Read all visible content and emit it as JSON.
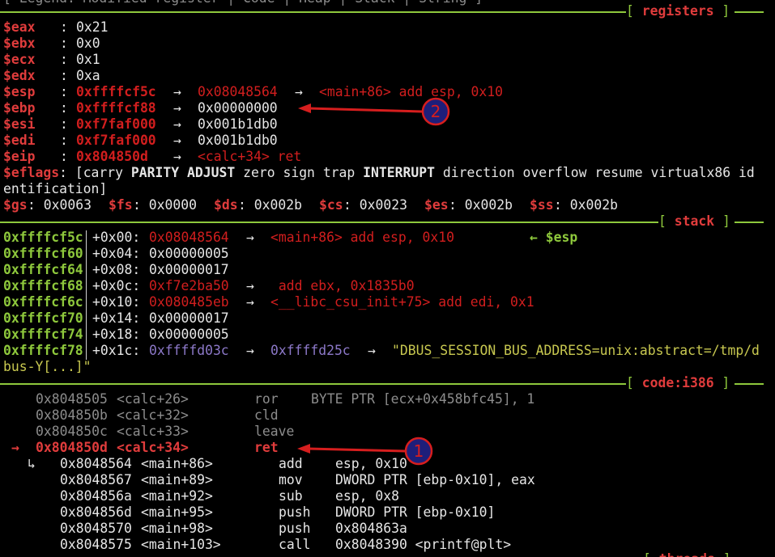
{
  "colors": {
    "background": "#000000",
    "register_name": "#e03c3c",
    "pointer": "#d21e1e",
    "section_rule": "#8ec83c",
    "stack_address": "#8ec83c",
    "text": "#d2d2d2",
    "string_value": "#c8c850",
    "heap_value": "#8c78c8",
    "annotation_arrow": "#d61e1e",
    "annotation_badge_fill": "#1e1e7a"
  },
  "top_partial_line": "[ Legend: Modified register | Code | Heap | Stack | String ]",
  "sections": {
    "registers": "registers",
    "stack": "stack",
    "code": "code:i386",
    "threads": "threads"
  },
  "registers": [
    {
      "name": "$eax",
      "value": "0x21",
      "chain": []
    },
    {
      "name": "$ebx",
      "value": "0x0",
      "chain": []
    },
    {
      "name": "$ecx",
      "value": "0x1",
      "chain": []
    },
    {
      "name": "$edx",
      "value": "0xa",
      "chain": []
    },
    {
      "name": "$esp",
      "value": "0xffffcf5c",
      "chain": [
        "0x08048564",
        "<main+86> add esp, 0x10"
      ]
    },
    {
      "name": "$ebp",
      "value": "0xffffcf88",
      "chain": [
        "0x00000000"
      ]
    },
    {
      "name": "$esi",
      "value": "0xf7faf000",
      "chain": [
        "0x001b1db0"
      ]
    },
    {
      "name": "$edi",
      "value": "0xf7faf000",
      "chain": [
        "0x001b1db0"
      ]
    },
    {
      "name": "$eip",
      "value": "0x804850d",
      "chain": [
        "<calc+34> ret"
      ]
    }
  ],
  "eflags": {
    "name": "$eflags",
    "open": "[",
    "flags": [
      "carry",
      "PARITY",
      "ADJUST",
      "zero",
      "sign",
      "trap",
      "INTERRUPT",
      "direction",
      "overflow",
      "resume",
      "virtualx86",
      "id"
    ],
    "wrap": "entification]"
  },
  "segments": [
    {
      "name": "$gs",
      "value": "0x0063"
    },
    {
      "name": "$fs",
      "value": "0x0000"
    },
    {
      "name": "$ds",
      "value": "0x002b"
    },
    {
      "name": "$cs",
      "value": "0x0023"
    },
    {
      "name": "$es",
      "value": "0x002b"
    },
    {
      "name": "$ss",
      "value": "0x002b"
    }
  ],
  "stack": [
    {
      "address": "0xffffcf5c",
      "offset": "+0x00:",
      "value": "0x08048564",
      "chain": [
        "<main+86> add esp, 0x10"
      ],
      "marker": "← $esp"
    },
    {
      "address": "0xffffcf60",
      "offset": "+0x04:",
      "value": "0x00000005",
      "chain": []
    },
    {
      "address": "0xffffcf64",
      "offset": "+0x08:",
      "value": "0x00000017",
      "chain": []
    },
    {
      "address": "0xffffcf68",
      "offset": "+0x0c:",
      "value": "0xf7e2ba50",
      "chain": [
        " add ebx, 0x1835b0"
      ]
    },
    {
      "address": "0xffffcf6c",
      "offset": "+0x10:",
      "value": "0x080485eb",
      "chain": [
        "<__libc_csu_init+75> add edi, 0x1"
      ]
    },
    {
      "address": "0xffffcf70",
      "offset": "+0x14:",
      "value": "0x00000017",
      "chain": []
    },
    {
      "address": "0xffffcf74",
      "offset": "+0x18:",
      "value": "0x00000005",
      "chain": []
    },
    {
      "address": "0xffffcf78",
      "offset": "+0x1c:",
      "value": "0xffffd03c",
      "chain": [
        "0xffffd25c",
        "\"DBUS_SESSION_BUS_ADDRESS=unix:abstract=/tmp/d"
      ],
      "wrap": "bus-Y[...]\""
    }
  ],
  "code": [
    {
      "addr": "0x8048505",
      "sym": "<calc+26>",
      "mnem": "ror",
      "ops": "BYTE PTR [ecx+0x458bfc45], 1",
      "state": "past"
    },
    {
      "addr": "0x804850b",
      "sym": "<calc+32>",
      "mnem": "cld",
      "ops": "",
      "state": "past"
    },
    {
      "addr": "0x804850c",
      "sym": "<calc+33>",
      "mnem": "leave",
      "ops": "",
      "state": "past"
    },
    {
      "addr": "0x804850d",
      "sym": "<calc+34>",
      "mnem": "ret",
      "ops": "",
      "state": "current",
      "marker": "→"
    },
    {
      "addr": "0x8048564",
      "sym": "<main+86>",
      "mnem": "add",
      "ops": "esp, 0x10",
      "state": "next",
      "marker": "↳"
    },
    {
      "addr": "0x8048567",
      "sym": "<main+89>",
      "mnem": "mov",
      "ops": "DWORD PTR [ebp-0x10], eax",
      "state": "next"
    },
    {
      "addr": "0x804856a",
      "sym": "<main+92>",
      "mnem": "sub",
      "ops": "esp, 0x8",
      "state": "next"
    },
    {
      "addr": "0x804856d",
      "sym": "<main+95>",
      "mnem": "push",
      "ops": "DWORD PTR [ebp-0x10]",
      "state": "next"
    },
    {
      "addr": "0x8048570",
      "sym": "<main+98>",
      "mnem": "push",
      "ops": "0x804863a",
      "state": "next"
    },
    {
      "addr": "0x8048575",
      "sym": "<main+103>",
      "mnem": "call",
      "ops": "0x8048390 <printf@plt>",
      "state": "next"
    }
  ],
  "annotations": [
    {
      "label": "1",
      "points_to": "ret instruction at <calc+34>"
    },
    {
      "label": "2",
      "points_to": "$ebp chain value 0x00000000"
    }
  ]
}
